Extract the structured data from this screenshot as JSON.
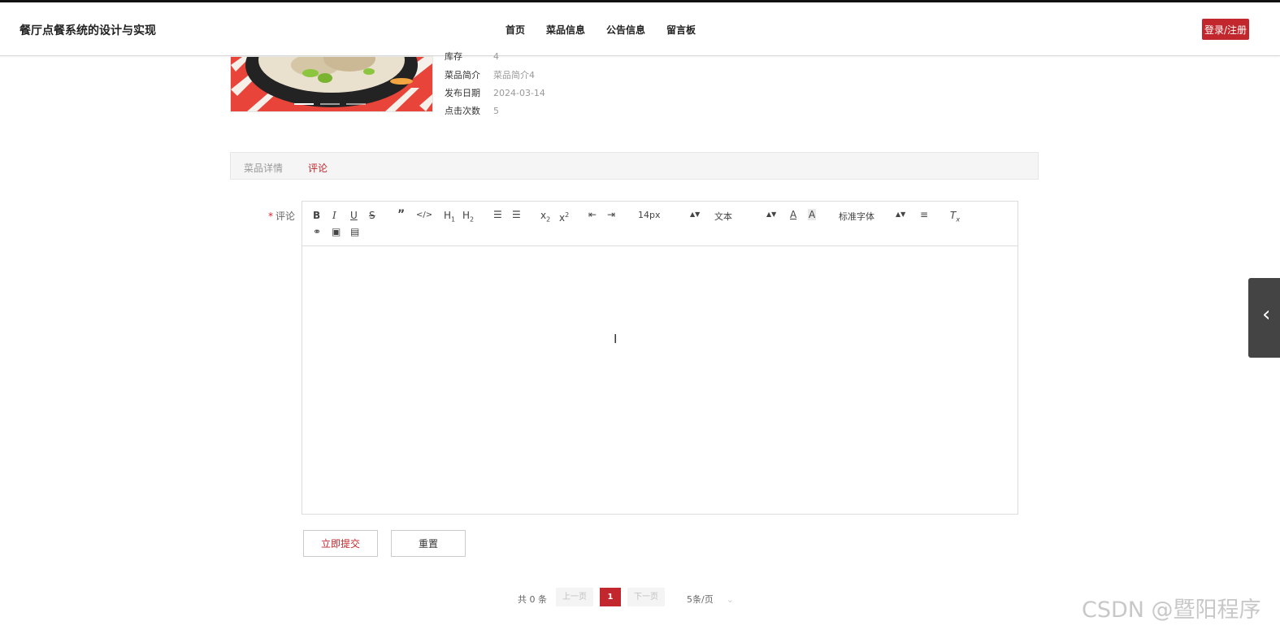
{
  "header": {
    "site_title": "餐厅点餐系统的设计与实现",
    "nav": [
      "首页",
      "菜品信息",
      "公告信息",
      "留言板"
    ],
    "login_label": "登录/注册"
  },
  "product": {
    "info": [
      {
        "label": "库存",
        "value": "4"
      },
      {
        "label": "菜品简介",
        "value": "菜品简介4"
      },
      {
        "label": "发布日期",
        "value": "2024-03-14"
      },
      {
        "label": "点击次数",
        "value": "5"
      }
    ]
  },
  "tabs": {
    "details": "菜品详情",
    "comments": "评论",
    "active": "comments"
  },
  "form": {
    "required_mark": "*",
    "comment_label": "评论",
    "toolbar": {
      "font_size": "14px",
      "header_select": "文本",
      "font_family": "标准字体",
      "icons": [
        "bold-icon",
        "italic-icon",
        "underline-icon",
        "strike-icon",
        "blockquote-icon",
        "code-block-icon",
        "header1-icon",
        "header2-icon",
        "ordered-list-icon",
        "bullet-list-icon",
        "subscript-icon",
        "superscript-icon",
        "outdent-icon",
        "indent-icon",
        "font-color-icon",
        "background-color-icon",
        "align-icon",
        "clean-format-icon",
        "link-icon",
        "image-icon",
        "video-icon"
      ]
    },
    "submit_label": "立即提交",
    "reset_label": "重置"
  },
  "pagination": {
    "total": "共 0 条",
    "prev": "上一页",
    "current": "1",
    "next": "下一页",
    "page_size": "5条/页"
  },
  "watermark": "CSDN @暨阳程序",
  "colors": {
    "accent": "#c1272d",
    "tab_active": "#c1272d"
  }
}
